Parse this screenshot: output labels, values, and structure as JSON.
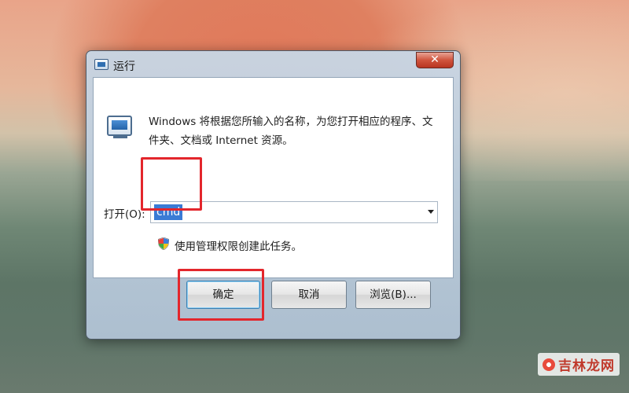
{
  "dialog": {
    "title": "运行",
    "close_label": "✕",
    "description": "Windows 将根据您所输入的名称，为您打开相应的程序、文件夹、文档或 Internet 资源。",
    "open_label": "打开(O):",
    "command_value": "cmd",
    "admin_note": "使用管理权限创建此任务。",
    "buttons": {
      "ok": "确定",
      "cancel": "取消",
      "browse": "浏览(B)..."
    }
  },
  "icons": {
    "title": "run-icon",
    "main": "run-icon",
    "shield": "uac-shield-icon",
    "dropdown": "chevron-down-icon"
  },
  "annotations": {
    "highlight_color": "#e3262c"
  },
  "watermark": {
    "text": "吉林龙网"
  }
}
